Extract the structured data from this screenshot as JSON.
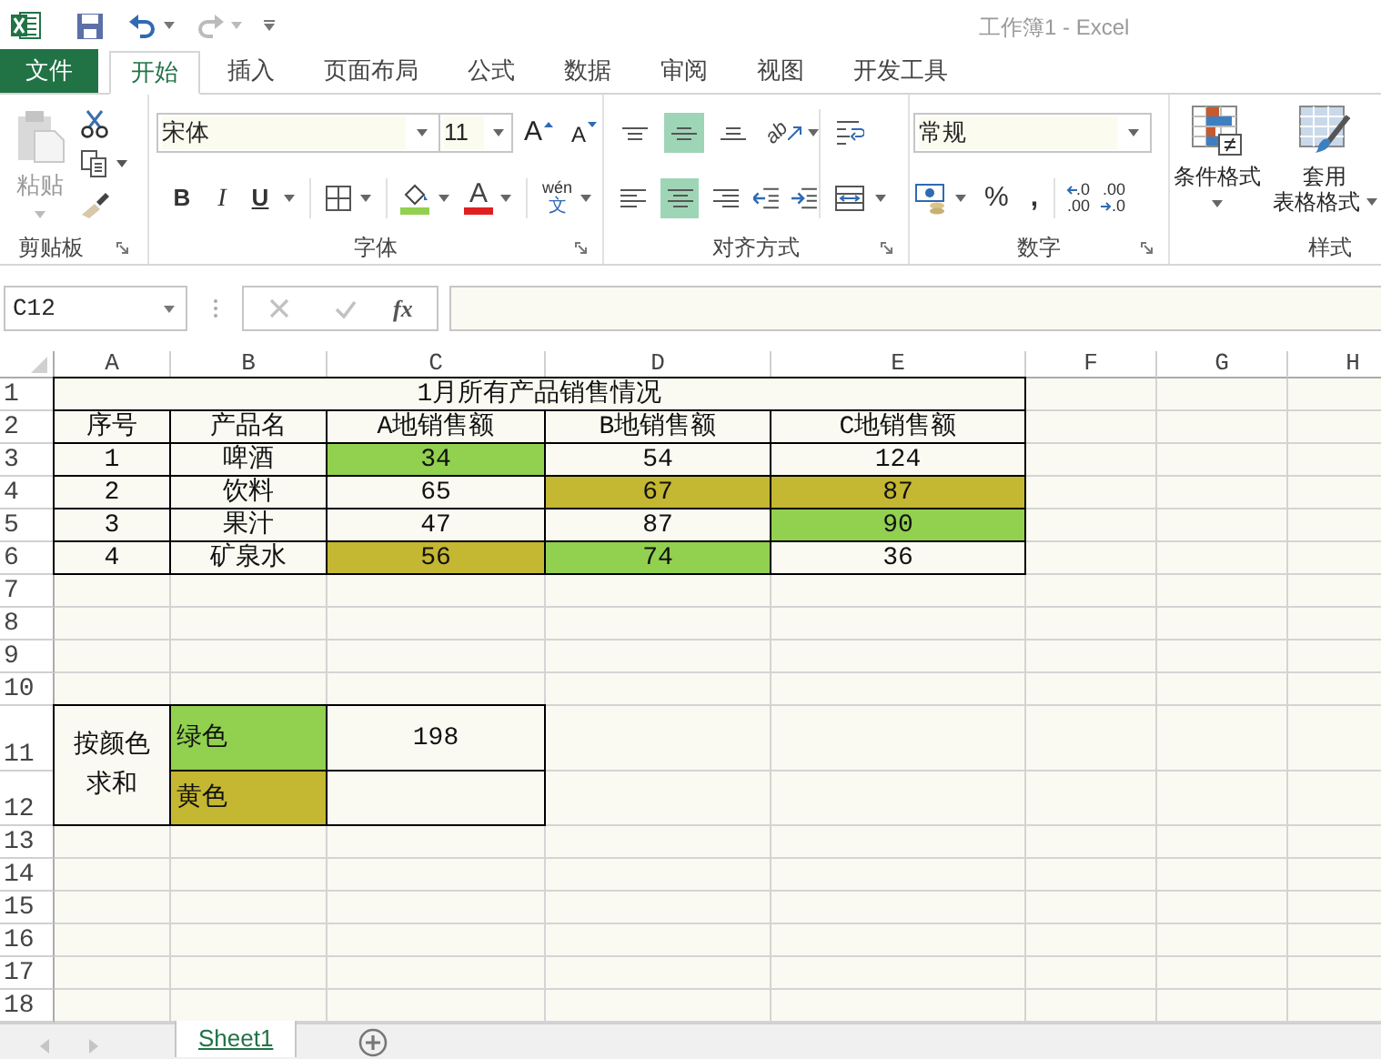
{
  "title_bar": {
    "title": "工作簿1 - Excel"
  },
  "tabs": [
    {
      "label": "文件",
      "kind": "file",
      "selected": false
    },
    {
      "label": "开始",
      "kind": "tab",
      "selected": true
    },
    {
      "label": "插入",
      "kind": "tab",
      "selected": false
    },
    {
      "label": "页面布局",
      "kind": "tab",
      "selected": false
    },
    {
      "label": "公式",
      "kind": "tab",
      "selected": false
    },
    {
      "label": "数据",
      "kind": "tab",
      "selected": false
    },
    {
      "label": "审阅",
      "kind": "tab",
      "selected": false
    },
    {
      "label": "视图",
      "kind": "tab",
      "selected": false
    },
    {
      "label": "开发工具",
      "kind": "tab",
      "selected": false
    }
  ],
  "ribbon": {
    "clipboard": {
      "label": "剪贴板",
      "paste": {
        "label": "粘贴",
        "disabled": true
      }
    },
    "font": {
      "label": "字体",
      "font_name": "宋体",
      "font_size": "11",
      "grow": "A",
      "shrink": "A",
      "bold": "B",
      "italic": "I",
      "underline": "U",
      "font_color": "A",
      "phonetic": {
        "top": "wén",
        "bottom": "文"
      }
    },
    "alignment": {
      "label": "对齐方式",
      "orientation": "ab",
      "vertical": [
        {
          "kind": "top",
          "selected": false
        },
        {
          "kind": "middle",
          "selected": true
        },
        {
          "kind": "bottom",
          "selected": false
        }
      ],
      "horizontal": [
        {
          "kind": "left",
          "selected": false
        },
        {
          "kind": "center",
          "selected": true
        },
        {
          "kind": "right",
          "selected": false
        }
      ]
    },
    "number": {
      "label": "数字",
      "format": "常规",
      "percent": "%",
      "comma": ",",
      "increase_decimal": {
        "top": ".0",
        "bottom": ".00"
      },
      "decrease_decimal": {
        "top": ".00",
        "bottom": ".0"
      }
    },
    "styles": {
      "label": "样式",
      "conditional_format": "条件格式",
      "format_as_table": {
        "top": "套用",
        "bottom": "表格格式"
      }
    }
  },
  "formula_bar": {
    "name_box": "C12",
    "fx": "fx"
  },
  "sheet": {
    "columns": [
      "A",
      "B",
      "C",
      "D",
      "E",
      "F",
      "G",
      "H"
    ],
    "rows": [
      {
        "header": "1",
        "kind": "normal",
        "cells": [
          {
            "text": "1月所有产品销售情况",
            "kind": "title"
          }
        ]
      },
      {
        "header": "2",
        "kind": "normal",
        "cells": [
          {
            "text": "序号"
          },
          {
            "text": "产品名"
          },
          {
            "text": "A地销售额"
          },
          {
            "text": "B地销售额"
          },
          {
            "text": "C地销售额"
          }
        ]
      },
      {
        "header": "3",
        "kind": "normal",
        "cells": [
          {
            "text": "1"
          },
          {
            "text": "啤酒"
          },
          {
            "text": "34",
            "color": "#92d050"
          },
          {
            "text": "54"
          },
          {
            "text": "124"
          }
        ]
      },
      {
        "header": "4",
        "kind": "normal",
        "cells": [
          {
            "text": "2"
          },
          {
            "text": "饮料"
          },
          {
            "text": "65"
          },
          {
            "text": "67",
            "color": "#c4b732"
          },
          {
            "text": "87",
            "color": "#c4b732"
          }
        ]
      },
      {
        "header": "5",
        "kind": "normal",
        "cells": [
          {
            "text": "3"
          },
          {
            "text": "果汁"
          },
          {
            "text": "47"
          },
          {
            "text": "87"
          },
          {
            "text": "90",
            "color": "#92d050"
          }
        ]
      },
      {
        "header": "6",
        "kind": "normal",
        "cells": [
          {
            "text": "4"
          },
          {
            "text": "矿泉水"
          },
          {
            "text": "56",
            "color": "#c4b732"
          },
          {
            "text": "74",
            "color": "#92d050"
          },
          {
            "text": "36"
          }
        ]
      },
      {
        "header": "7",
        "kind": "normal"
      },
      {
        "header": "8",
        "kind": "normal"
      },
      {
        "header": "9",
        "kind": "normal"
      },
      {
        "header": "10",
        "kind": "normal"
      },
      {
        "header": "11",
        "kind": "tall",
        "cells": [
          {
            "text": "按颜色求和",
            "kind": "merged"
          },
          {
            "text": "绿色",
            "kind": "label",
            "color": "#92d050"
          },
          {
            "text": "198"
          }
        ]
      },
      {
        "header": "12",
        "kind": "medium",
        "cells": [
          {
            "text": "黄色",
            "kind": "label",
            "color": "#c4b732"
          },
          {
            "kind": "empty"
          }
        ]
      },
      {
        "header": "13",
        "kind": "normal"
      },
      {
        "header": "14",
        "kind": "normal"
      },
      {
        "header": "15",
        "kind": "normal"
      },
      {
        "header": "16",
        "kind": "normal"
      },
      {
        "header": "17",
        "kind": "normal"
      },
      {
        "header": "18",
        "kind": "normal"
      }
    ]
  },
  "sheet_tabs": [
    {
      "label": "Sheet1",
      "selected": true
    }
  ]
}
